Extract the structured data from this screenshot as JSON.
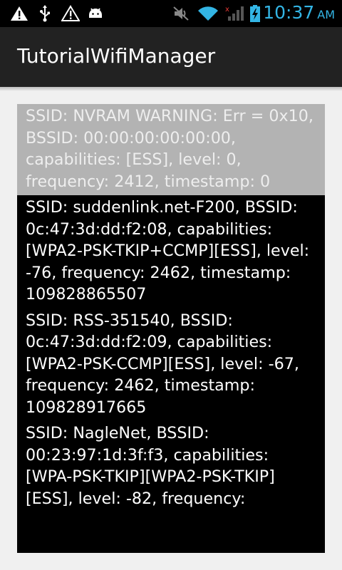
{
  "status_bar": {
    "time": "10:37",
    "ampm": "AM",
    "icons": [
      "warning-icon",
      "usb-icon",
      "alert-icon",
      "android-debug-icon",
      "mute-icon",
      "wifi-icon",
      "signal-icon",
      "battery-icon"
    ],
    "accent_color": "#33b5e5"
  },
  "action_bar": {
    "title": "TutorialWifiManager"
  },
  "wifi_list": {
    "items": [
      {
        "text": "SSID: NVRAM WARNING: Err = 0x10, BSSID: 00:00:00:00:00:00, capabilities: [ESS], level: 0, frequency: 2412, timestamp: 0",
        "selected": true
      },
      {
        "text": "SSID: suddenlink.net-F200, BSSID: 0c:47:3d:dd:f2:08, capabilities: [WPA2-PSK-TKIP+CCMP][ESS], level: -76, frequency: 2462, timestamp: 109828865507",
        "selected": false
      },
      {
        "text": "SSID: RSS-351540, BSSID: 0c:47:3d:dd:f2:09, capabilities: [WPA2-PSK-CCMP][ESS], level: -67, frequency: 2462, timestamp: 109828917665",
        "selected": false
      },
      {
        "text": "SSID: NagleNet, BSSID: 00:23:97:1d:3f:f3, capabilities: [WPA-PSK-TKIP][WPA2-PSK-TKIP][ESS], level: -82, frequency:",
        "selected": false
      }
    ]
  }
}
